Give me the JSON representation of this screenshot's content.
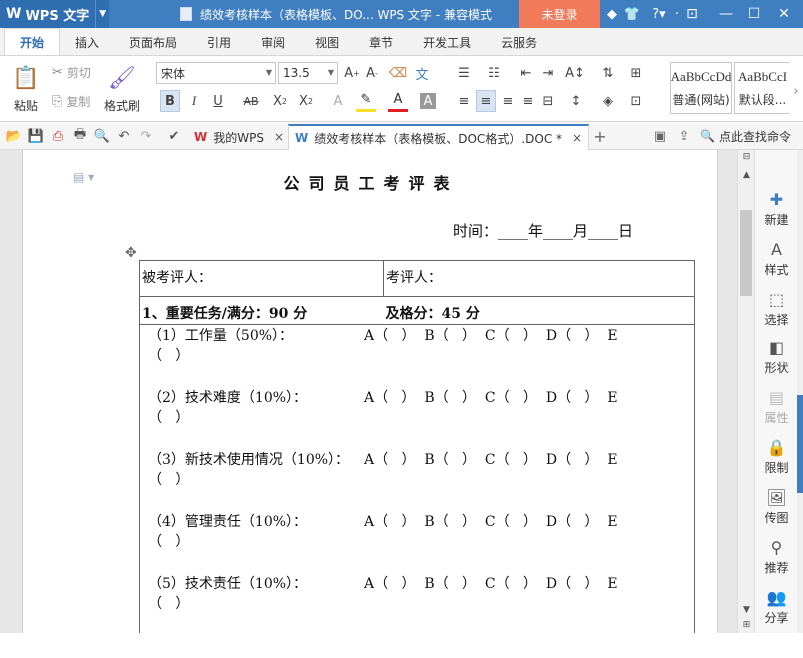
{
  "app": {
    "logo_text": "WPS 文字",
    "logo_mark": "W"
  },
  "titlebar": {
    "doc_title": "绩效考核样本（表格模板、DO... WPS 文字 - 兼容模式",
    "login_label": "未登录"
  },
  "ribbon_tabs": [
    "开始",
    "插入",
    "页面布局",
    "引用",
    "审阅",
    "视图",
    "章节",
    "开发工具",
    "云服务"
  ],
  "ribbon": {
    "paste_label": "粘贴",
    "cut_label": "剪切",
    "copy_label": "复制",
    "format_painter_label": "格式刷",
    "font_name": "宋体",
    "font_size": "13.5",
    "styles": [
      {
        "sample": "AaBbCcDd",
        "label": "普通(网站)"
      },
      {
        "sample": "AaBbCcI",
        "label": "默认段..."
      }
    ]
  },
  "quickbar": {
    "tabs": [
      {
        "label": "我的WPS",
        "close": "×"
      },
      {
        "label": "绩效考核样本（表格模板、DOC格式）.DOC *",
        "close": "×"
      }
    ],
    "new_tab": "+",
    "command_search": "点此查找命令"
  },
  "document": {
    "title": "公司员工考评表",
    "date_line": "时间：____年____月____日",
    "evaluatee_label": "被考评人：",
    "evaluator_label": "考评人：",
    "section1_title": "1、重要任务/满分：90 分",
    "section1_pass": "及格分：45 分",
    "grade_options": "A（   ）  B（   ）  C（   ）  D（   ）  E",
    "grade_continuation": "（   ）",
    "tasks": [
      {
        "name": "（1）工作量（50%）："
      },
      {
        "name": "（2）技术难度（10%）："
      },
      {
        "name": "（3）新技术使用情况（10%）："
      },
      {
        "name": "（4）管理责任（10%）："
      },
      {
        "name": "（5）技术责任（10%）："
      }
    ]
  },
  "taskpane": [
    {
      "label": "新建",
      "icon": "new-icon",
      "enabled": true
    },
    {
      "label": "样式",
      "icon": "style-icon",
      "enabled": true
    },
    {
      "label": "选择",
      "icon": "select-icon",
      "enabled": true
    },
    {
      "label": "形状",
      "icon": "shape-icon",
      "enabled": true
    },
    {
      "label": "属性",
      "icon": "property-icon",
      "enabled": false
    },
    {
      "label": "限制",
      "icon": "restrict-icon",
      "enabled": true
    },
    {
      "label": "传图",
      "icon": "upload-image-icon",
      "enabled": true
    },
    {
      "label": "推荐",
      "icon": "recommend-icon",
      "enabled": true
    },
    {
      "label": "分享",
      "icon": "share-icon",
      "enabled": true
    }
  ],
  "colors": {
    "titlebar": "#3f7fc1",
    "login_button": "#f07a5a",
    "accent": "#2f6eb1"
  }
}
